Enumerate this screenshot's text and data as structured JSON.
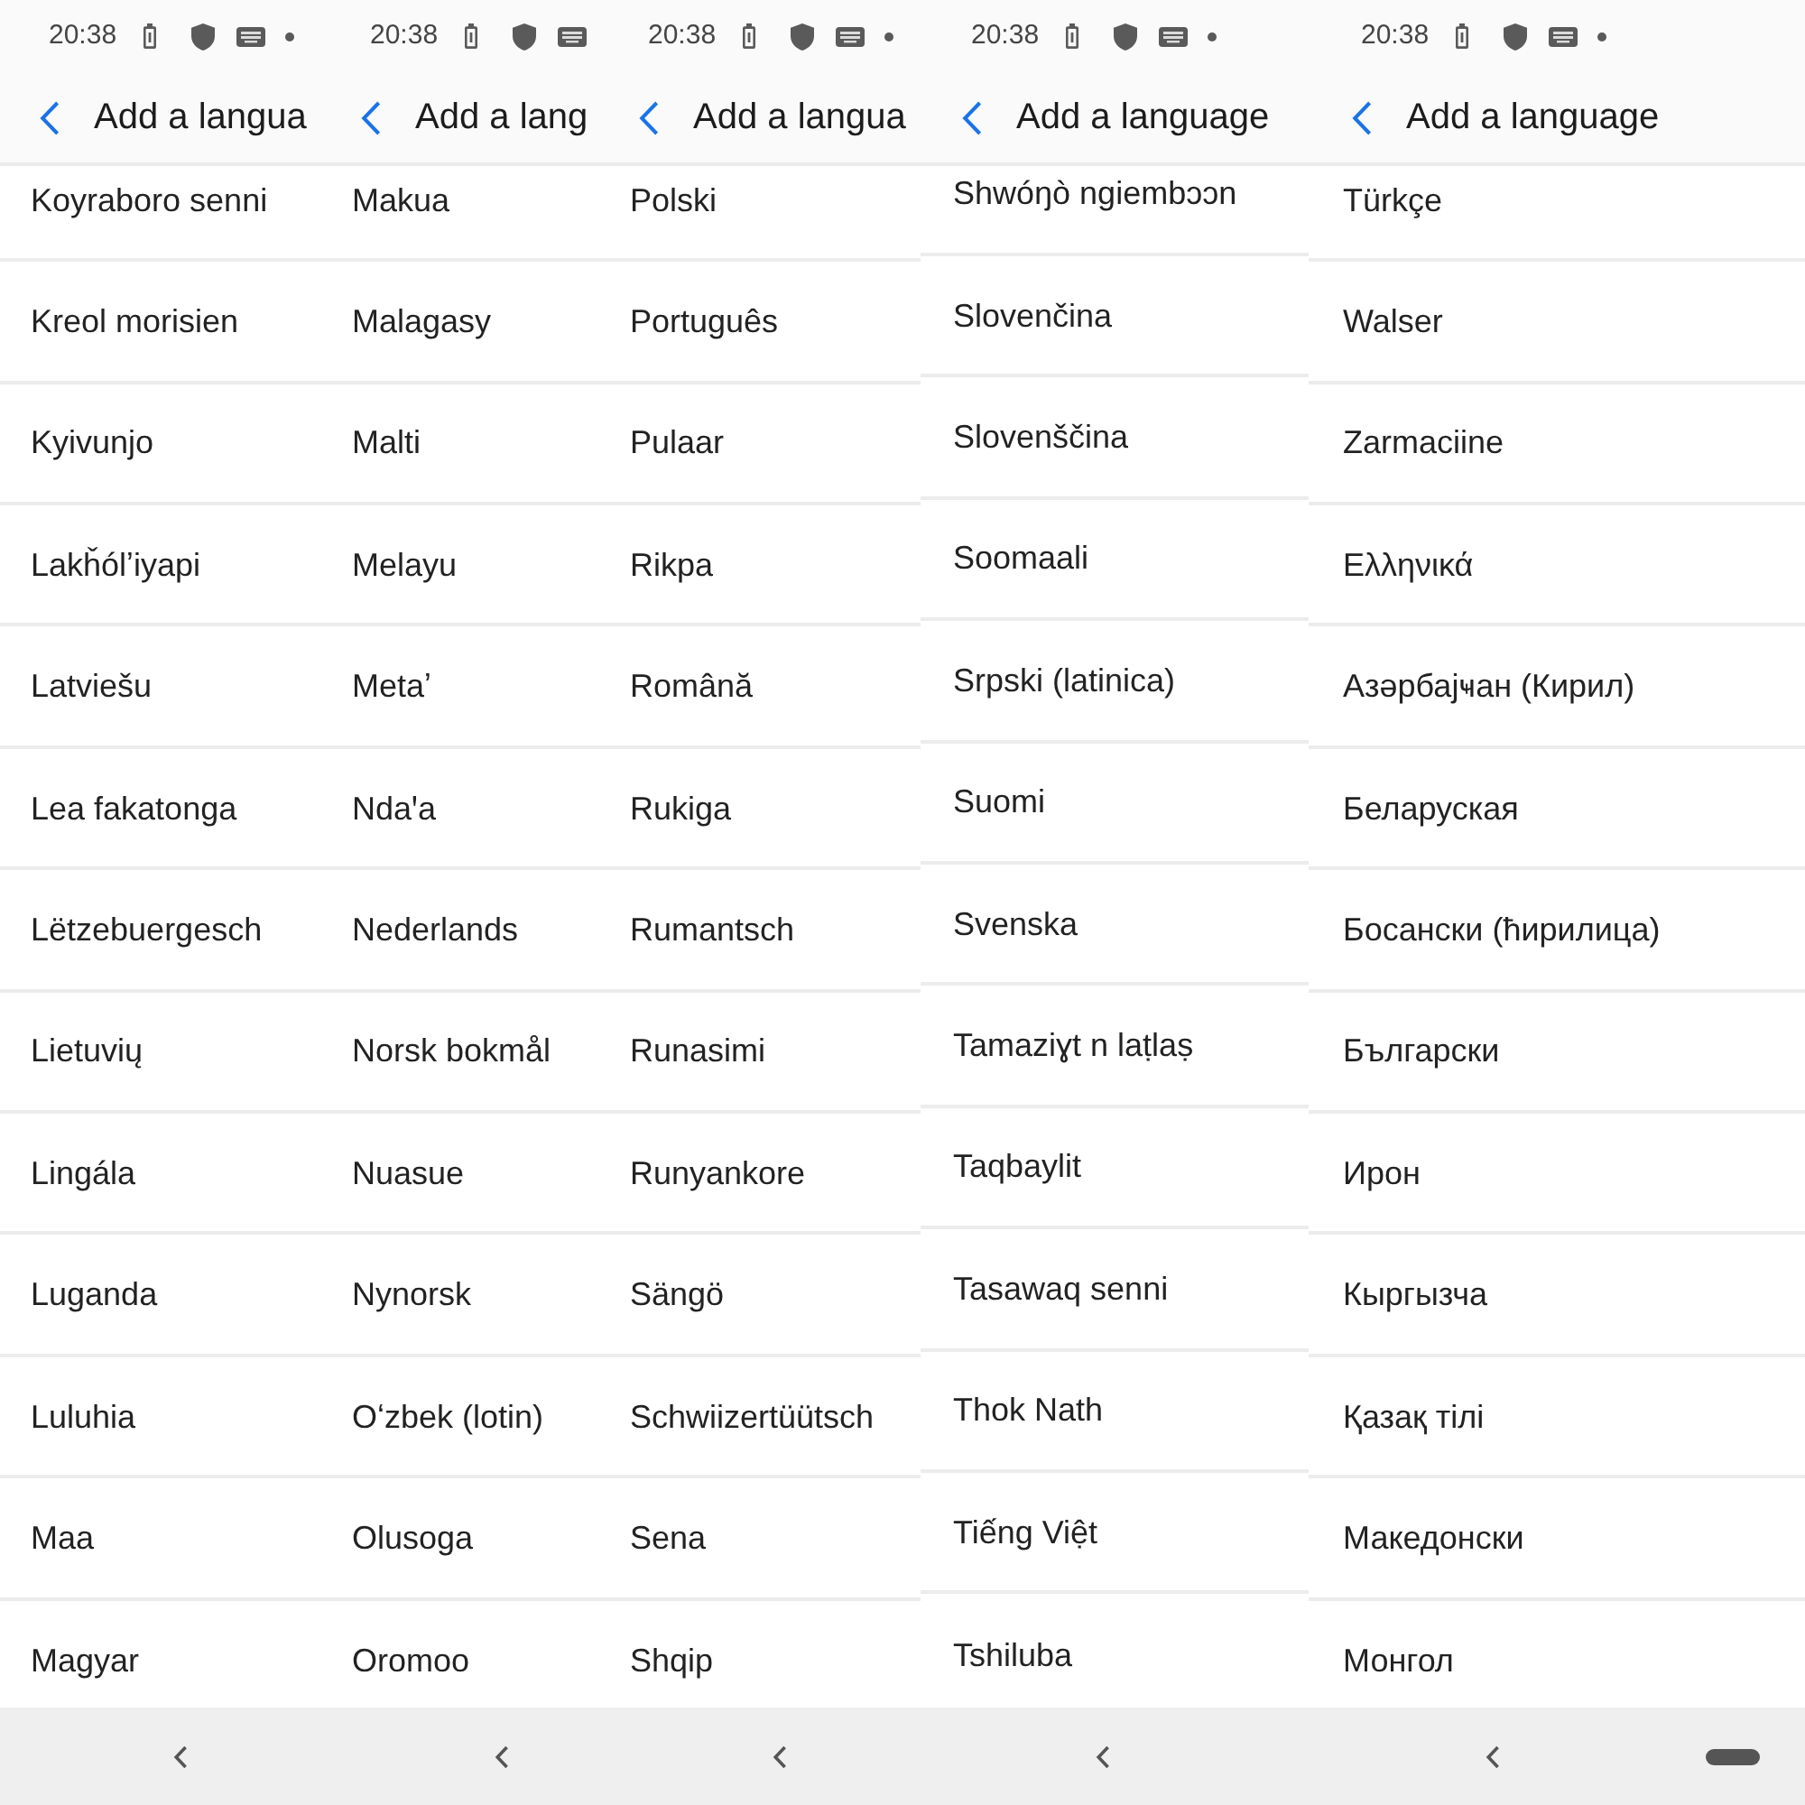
{
  "panels": [
    {
      "status_bar": {
        "time": "20:38",
        "notification_dot": true
      },
      "header": {
        "title": "Add a langua"
      },
      "languages": [
        "Koyraboro senni",
        "Kreol morisien",
        "Kyivunjo",
        "Lakȟólʼiyapi",
        "Latviešu",
        "Lea fakatonga",
        "Lëtzebuergesch",
        "Lietuvių",
        "Lingála",
        "Luganda",
        "Luluhia",
        "Maa",
        "Magyar"
      ],
      "nav_bar": {
        "home_handle": false
      }
    },
    {
      "status_bar": {
        "time": "20:38",
        "notification_dot": false
      },
      "header": {
        "title": "Add a lang"
      },
      "languages": [
        "Makua",
        "Malagasy",
        "Malti",
        "Melayu",
        "Metaʼ",
        "Ndaꞌa",
        "Nederlands",
        "Norsk bokmål",
        "Nuasue",
        "Nynorsk",
        "Oʻzbek (lotin)",
        "Olusoga",
        "Oromoo"
      ],
      "nav_bar": {
        "home_handle": false
      }
    },
    {
      "status_bar": {
        "time": "20:38",
        "notification_dot": true
      },
      "header": {
        "title": "Add a langua"
      },
      "languages": [
        "Polski",
        "Português",
        "Pulaar",
        "Rikpa",
        "Română",
        "Rukiga",
        "Rumantsch",
        "Runasimi",
        "Runyankore",
        "Sängö",
        "Schwiizertüütsch",
        "Sena",
        "Shqip"
      ],
      "nav_bar": {
        "home_handle": false
      }
    },
    {
      "status_bar": {
        "time": "20:38",
        "notification_dot": true
      },
      "header": {
        "title": "Add a language"
      },
      "languages": [
        "Shwóŋò ngiembɔɔn",
        "Slovenčina",
        "Slovenščina",
        "Soomaali",
        "Srpski (latinica)",
        "Suomi",
        "Svenska",
        "Tamaziɣt n laṭlaṣ",
        "Taqbaylit",
        "Tasawaq senni",
        "Thok Nath",
        "Tiếng Việt",
        "Tshiluba"
      ],
      "nav_bar": {
        "home_handle": false
      }
    },
    {
      "status_bar": {
        "time": "20:38",
        "notification_dot": true
      },
      "header": {
        "title": "Add a language"
      },
      "languages": [
        "Türkçe",
        "Walser",
        "Zarmaciine",
        "Ελληνικά",
        "Азәрбајҹан (Кирил)",
        "Беларуская",
        "Босански (ћирилица)",
        "Български",
        "Ирон",
        "Кыргызча",
        "Қазақ тілі",
        "Македонски",
        "Монгол"
      ],
      "nav_bar": {
        "home_handle": true
      }
    }
  ]
}
